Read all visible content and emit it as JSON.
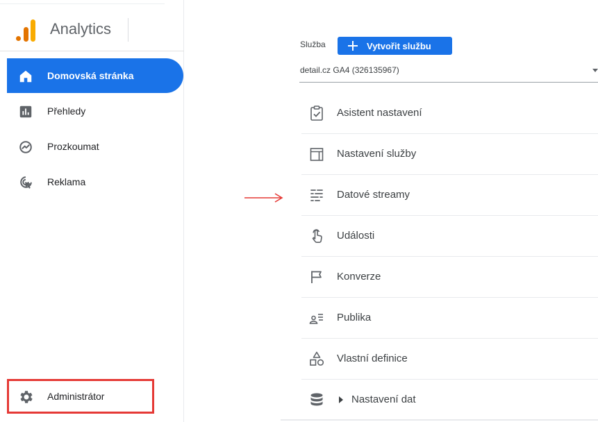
{
  "app": {
    "name": "Analytics"
  },
  "nav": {
    "items": [
      {
        "label": "Domovská stránka",
        "icon": "home-icon",
        "active": true
      },
      {
        "label": "Přehledy",
        "icon": "reports-icon",
        "active": false
      },
      {
        "label": "Prozkoumat",
        "icon": "explore-icon",
        "active": false
      },
      {
        "label": "Reklama",
        "icon": "advertising-icon",
        "active": false
      }
    ],
    "admin_label": "Administrátor",
    "admin_icon": "gear-icon",
    "highlight_color": "#e53935"
  },
  "property": {
    "label": "Služba",
    "create_button": "Vytvořit službu",
    "selected": "detail.cz GA4 (326135967)"
  },
  "menu": {
    "items": [
      {
        "label": "Asistent nastavení",
        "icon": "setup-assistant-icon"
      },
      {
        "label": "Nastavení služby",
        "icon": "property-settings-icon"
      },
      {
        "label": "Datové streamy",
        "icon": "data-streams-icon"
      },
      {
        "label": "Události",
        "icon": "events-icon"
      },
      {
        "label": "Konverze",
        "icon": "conversions-flag-icon"
      },
      {
        "label": "Publika",
        "icon": "audiences-icon"
      },
      {
        "label": "Vlastní definice",
        "icon": "custom-definitions-icon"
      },
      {
        "label": "Nastavení dat",
        "icon": "data-settings-icon",
        "expandable": true
      }
    ]
  },
  "colors": {
    "accent": "#1a73e8",
    "arrow": "#e53935",
    "logo_orange": "#f9ab00",
    "logo_dark": "#e37400"
  }
}
